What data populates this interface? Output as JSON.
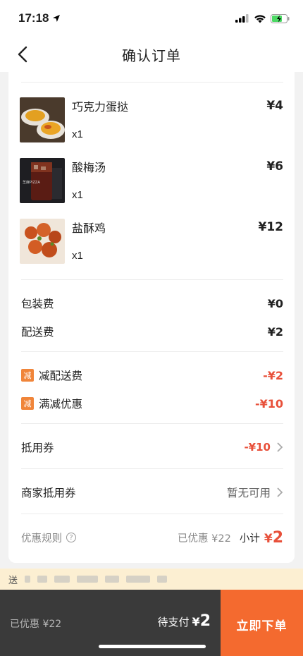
{
  "status_bar": {
    "time": "17:18"
  },
  "nav": {
    "title": "确认订单"
  },
  "items": [
    {
      "name": "巧克力蛋挞",
      "qty": "x1",
      "price": "¥4"
    },
    {
      "name": "酸梅汤",
      "qty": "x1",
      "price": "¥6"
    },
    {
      "name": "盐酥鸡",
      "qty": "x1",
      "price": "¥12"
    }
  ],
  "fees": {
    "packaging_label": "包装费",
    "packaging_value": "¥0",
    "delivery_label": "配送费",
    "delivery_value": "¥2"
  },
  "discounts": {
    "tag": "减",
    "delivery_discount_label": "减配送费",
    "delivery_discount_value": "-¥2",
    "full_reduction_label": "满减优惠",
    "full_reduction_value": "-¥10"
  },
  "coupons": {
    "voucher_label": "抵用券",
    "voucher_value": "-¥10",
    "merchant_voucher_label": "商家抵用券",
    "merchant_voucher_value": "暂无可用"
  },
  "summary": {
    "rules_label": "优惠规则",
    "saved": "已优惠 ¥22",
    "subtotal_label": "小计",
    "subtotal_currency": "¥",
    "subtotal_amount": "2"
  },
  "notice": {
    "prefix": "送"
  },
  "bottom": {
    "saved": "已优惠 ¥22",
    "to_pay_label": "待支付",
    "to_pay_currency": "¥",
    "to_pay_amount": "2",
    "order_button": "立即下单"
  },
  "colors": {
    "accent": "#f46a2f",
    "discount_red": "#e8503a",
    "tag_orange": "#f0853a",
    "notice_bg": "#fcefd2",
    "bottom_bg": "#3a3a3a"
  }
}
